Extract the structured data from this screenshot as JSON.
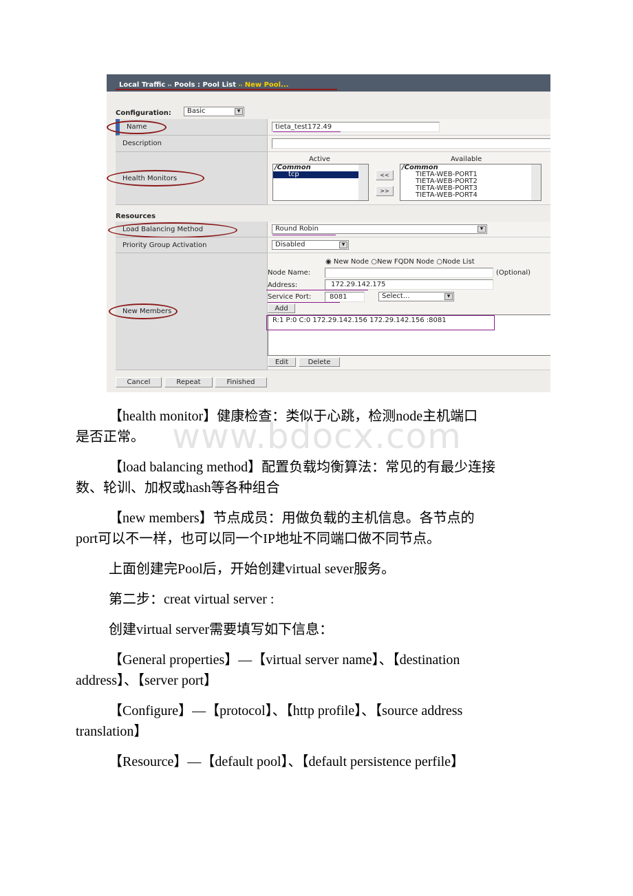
{
  "screenshot": {
    "breadcrumb": {
      "part1": "Local Traffic",
      "sep": "››",
      "part2": "Pools : Pool List",
      "part3": "New Pool..."
    },
    "configuration": {
      "label": "Configuration:",
      "value": "Basic"
    },
    "name": {
      "label": "Name",
      "value": "tieta_test172.49"
    },
    "description": {
      "label": "Description",
      "value": ""
    },
    "health_monitors": {
      "label": "Health Monitors",
      "active_label": "Active",
      "available_label": "Available",
      "active_group": "/Common",
      "active_items": [
        "tcp"
      ],
      "available_group": "/Common",
      "available_items": [
        "TIETA-WEB-PORT1",
        "TIETA-WEB-PORT2",
        "TIETA-WEB-PORT3",
        "TIETA-WEB-PORT4"
      ],
      "move_left": "<<",
      "move_right": ">>"
    },
    "resources_label": "Resources",
    "lb_method": {
      "label": "Load Balancing Method",
      "value": "Round Robin"
    },
    "pga": {
      "label": "Priority Group Activation",
      "value": "Disabled"
    },
    "new_members": {
      "label": "New Members",
      "radio_new_node": "New Node",
      "radio_fqdn": "New FQDN Node",
      "radio_node_list": "Node List",
      "selected_radio": "New Node",
      "node_name_label": "Node Name:",
      "node_name_value": "",
      "optional": "(Optional)",
      "address_label": "Address:",
      "address_value": "172.29.142.175",
      "port_label": "Service Port:",
      "port_value": "8081",
      "port_select": "Select...",
      "add": "Add",
      "members": [
        "R:1 P:0 C:0 172.29.142.156 172.29.142.156 :8081"
      ],
      "edit": "Edit",
      "delete": "Delete"
    },
    "buttons": {
      "cancel": "Cancel",
      "repeat": "Repeat",
      "finished": "Finished"
    },
    "colors": {
      "header": "#505c6b",
      "breadcrumb_current": "#f5d000",
      "annotation_oval": "#8b1a1a",
      "annotation_underline": "#8a1a8a"
    }
  },
  "watermark": "www.bdocx.com",
  "paragraphs": [
    {
      "l1": "【health monitor】健康检查：类似于心跳，检测node主机端口",
      "l2": "是否正常。"
    },
    {
      "l1": "【load balancing method】配置负载均衡算法：常见的有最少连接",
      "l2": "数、轮训、加权或hash等各种组合"
    },
    {
      "l1": "【new members】节点成员：用做负载的主机信息。各节点的",
      "l2": "port可以不一样，也可以同一个IP地址不同端口做不同节点。"
    },
    {
      "l1": "上面创建完Pool后，开始创建virtual sever服务。"
    },
    {
      "l1": "第二步：creat virtual server :"
    },
    {
      "l1": "创建virtual server需要填写如下信息："
    },
    {
      "l1": "【General properties】—【virtual server name】、【destination",
      "l2": "address】、【server port】"
    },
    {
      "l1": "【Configure】—【protocol】、【http profile】、【source address",
      "l2": "translation】"
    },
    {
      "l1": "【Resource】—【default pool】、【default persistence perfile】"
    }
  ]
}
